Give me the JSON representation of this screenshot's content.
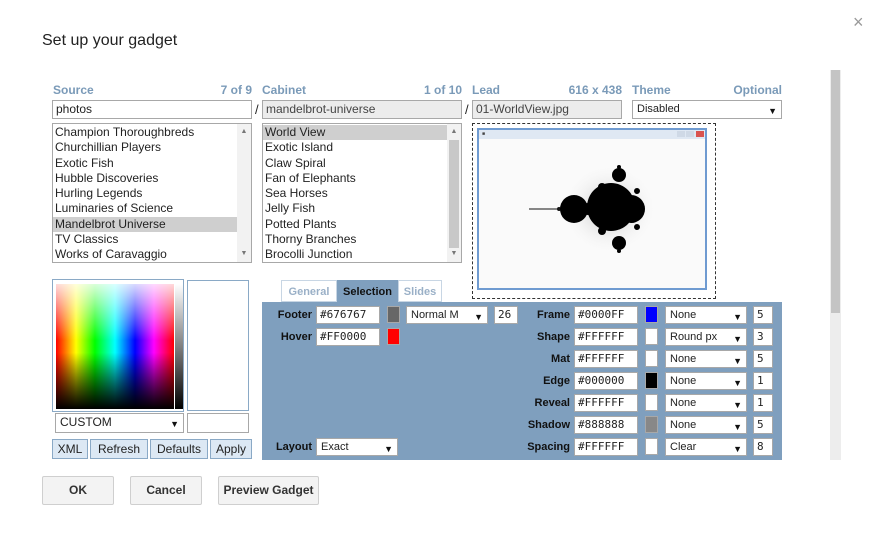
{
  "dialog": {
    "title": "Set up your gadget",
    "close_glyph": "×"
  },
  "source": {
    "label": "Source",
    "count": "7 of 9",
    "value": "photos",
    "items": [
      "Champion Thoroughbreds",
      "Churchillian Players",
      "Exotic Fish",
      "Hubble Discoveries",
      "Hurling Legends",
      "Luminaries of Science",
      "Mandelbrot Universe",
      "TV Classics",
      "Works of Caravaggio"
    ],
    "selected": "Mandelbrot Universe"
  },
  "cabinet": {
    "label": "Cabinet",
    "count": "1 of 10",
    "value": "mandelbrot-universe",
    "items": [
      "World View",
      "Exotic Island",
      "Claw Spiral",
      "Fan of Elephants",
      "Sea Horses",
      "Jelly Fish",
      "Potted Plants",
      "Thorny Branches",
      "Brocolli Junction"
    ],
    "selected": "World View"
  },
  "lead": {
    "label": "Lead",
    "size": "616 x 438",
    "value": "01-WorldView.jpg"
  },
  "theme": {
    "label": "Theme",
    "optional": "Optional",
    "value": "Disabled"
  },
  "separator": "/",
  "palette": {
    "select_value": "CUSTOM"
  },
  "color_buttons": {
    "xml": "XML",
    "refresh": "Refresh",
    "defaults": "Defaults",
    "apply": "Apply"
  },
  "tabs": {
    "general": "General",
    "selection": "Selection",
    "slides": "Slides",
    "active": "Selection"
  },
  "settings": {
    "footer": {
      "label": "Footer",
      "hex": "#676767",
      "color": "#676767",
      "font": "Normal M",
      "size": "26"
    },
    "hover": {
      "label": "Hover",
      "hex": "#FF0000",
      "color": "#FF0000"
    },
    "layout": {
      "label": "Layout",
      "value": "Exact"
    },
    "rows": [
      {
        "label": "Frame",
        "hex": "#0000FF",
        "color": "#0000FF",
        "style": "None",
        "num": "5"
      },
      {
        "label": "Shape",
        "hex": "#FFFFFF",
        "color": "#FFFFFF",
        "style": "Round px",
        "num": "3"
      },
      {
        "label": "Mat",
        "hex": "#FFFFFF",
        "color": "#FFFFFF",
        "style": "None",
        "num": "5"
      },
      {
        "label": "Edge",
        "hex": "#000000",
        "color": "#000000",
        "style": "None",
        "num": "1"
      },
      {
        "label": "Reveal",
        "hex": "#FFFFFF",
        "color": "#FFFFFF",
        "style": "None",
        "num": "1"
      },
      {
        "label": "Shadow",
        "hex": "#888888",
        "color": "#888888",
        "style": "None",
        "num": "5"
      },
      {
        "label": "Spacing",
        "hex": "#FFFFFF",
        "color": "#FFFFFF",
        "style": "Clear",
        "num": "8"
      }
    ]
  },
  "footer_buttons": {
    "ok": "OK",
    "cancel": "Cancel",
    "preview": "Preview Gadget"
  },
  "colors": {
    "header_blue": "#7a9ab8",
    "panel_blue": "#7f9fbe",
    "selection_grey": "#cfcfcf"
  }
}
